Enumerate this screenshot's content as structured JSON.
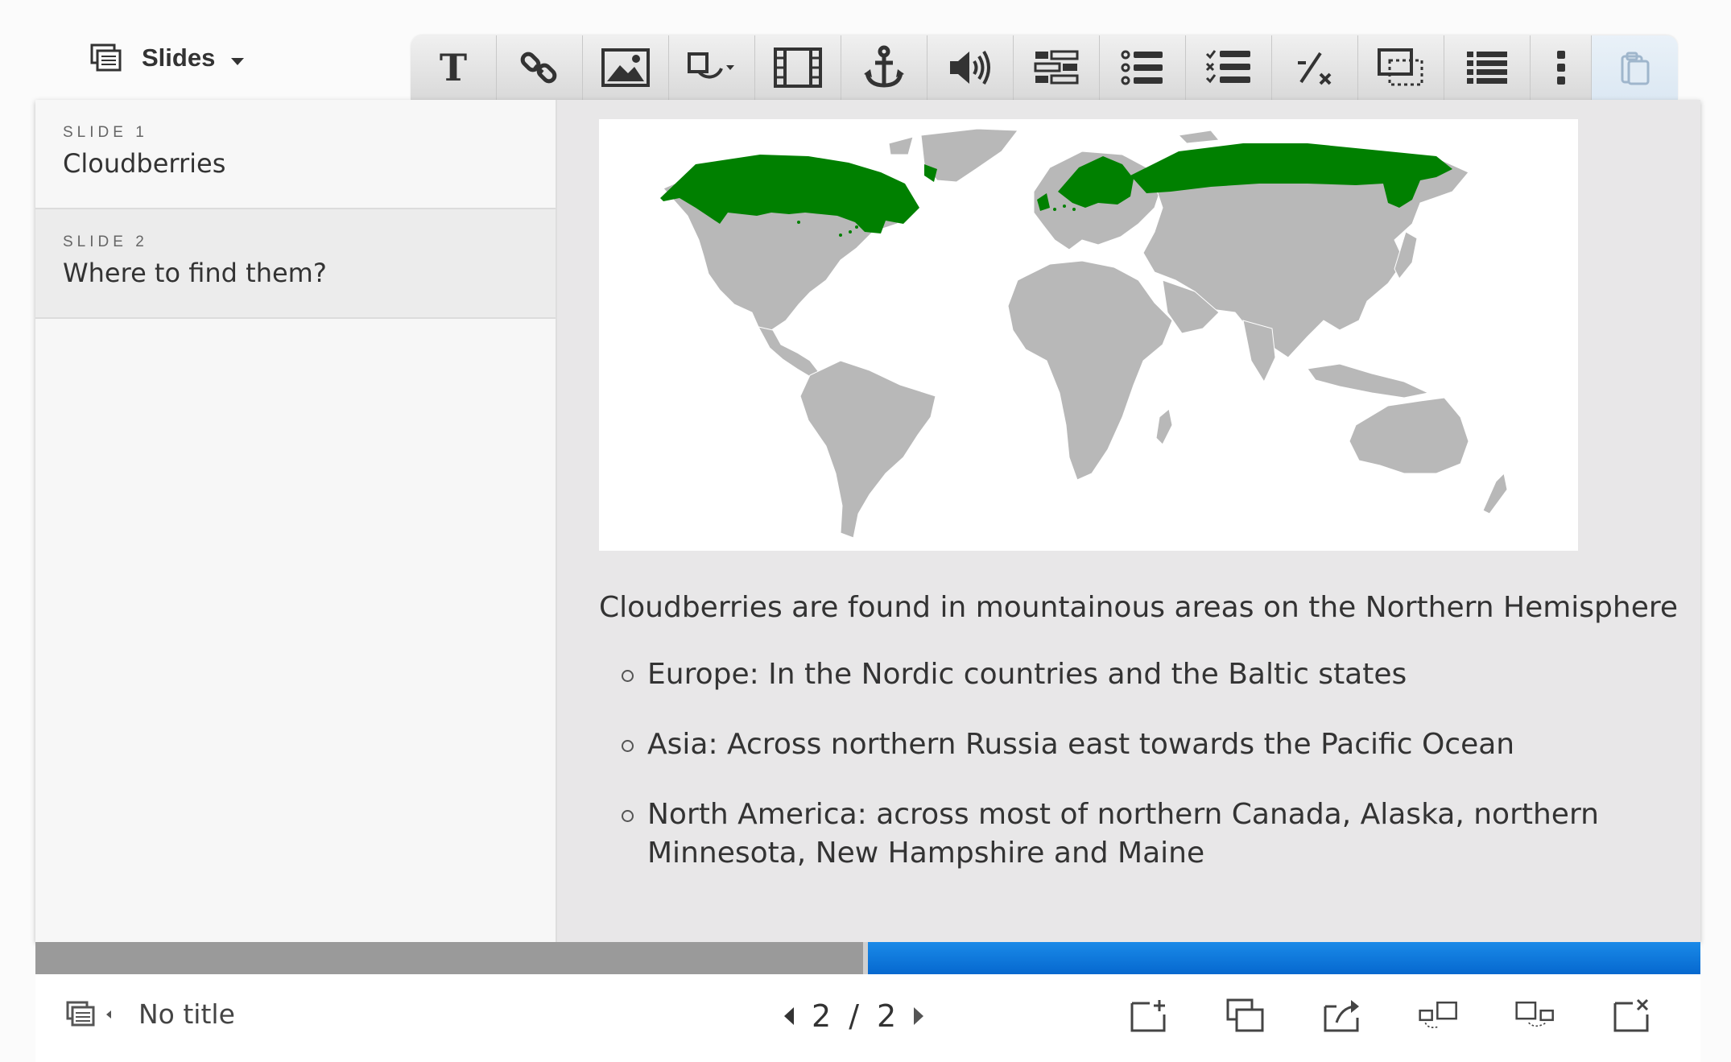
{
  "header": {
    "slides_menu_label": "Slides"
  },
  "toolbar": {
    "tools": [
      "text-icon",
      "link-icon",
      "image-icon",
      "shapes-icon",
      "video-icon",
      "anchor-icon",
      "audio-icon",
      "table-icon",
      "bullet-list-icon",
      "checklist-icon",
      "fraction-icon",
      "slide-template-icon",
      "list-icon",
      "more-icon",
      "paste-icon"
    ]
  },
  "sidebar": {
    "slides": [
      {
        "num": "SLIDE 1",
        "title": "Cloudberries"
      },
      {
        "num": "SLIDE 2",
        "title": "Where to find them?"
      }
    ]
  },
  "slide": {
    "heading": "Cloudberries are found in mountainous areas on the Northern Hemisphere",
    "bullets": [
      "Europe: In the Nordic countries and the Baltic states",
      "Asia: Across northern Russia east towards the Pacific Ocean",
      "North America: across most of northern Canada, Alaska, northern Minnesota, New Hampshire and Maine"
    ],
    "map": {
      "land_color": "#b8b8b8",
      "highlight_color": "#008000"
    }
  },
  "progress": {
    "current": 2,
    "total": 2,
    "fill_fraction": 0.5,
    "accent": "#0a78e0"
  },
  "footer": {
    "title": "No title",
    "page_current": "2",
    "page_sep": "/",
    "page_total": "2"
  }
}
